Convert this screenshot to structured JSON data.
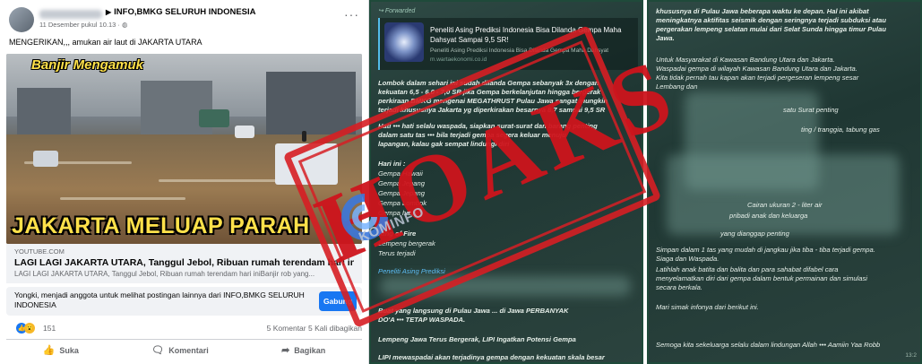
{
  "facebook": {
    "page_name": "INFO,BMKG SELURUH INDONESIA",
    "post_date": "11 Desember pukul 10.13 · ",
    "caption": "MENGERIKAN,,, amukan air laut di JAKARTA UTARA",
    "more_label": "···",
    "image_title_top": "Banjir Mengamuk",
    "image_title_bottom": "JAKARTA MELUAP PARAH",
    "link": {
      "domain": "YOUTUBE.COM",
      "title": "LAGI LAGI JAKARTA UTARA, Tanggul Jebol, Ribuan rumah terendam hari ini",
      "description": "LAGI LAGI JAKARTA UTARA, Tanggul Jebol, Ribuan rumah terendam hari iniBanjir rob yang..."
    },
    "join_prompt": "Yongki, menjadi anggota untuk melihat postingan lainnya dari INFO,BMKG SELURUH INDONESIA",
    "join_button": "Gabung",
    "reaction_count": "151",
    "comments_shares": "5 Komentar  5 Kali dibagikan",
    "actions": {
      "like": "Suka",
      "comment": "Komentari",
      "share": "Bagikan"
    },
    "icons": {
      "like": "thumbs-up-icon",
      "comment": "speech-bubble-icon",
      "share": "share-arrow-icon"
    }
  },
  "chat_left": {
    "forwarded": "Forwarded",
    "preview_title": "Peneliti Asing Prediksi Indonesia Bisa Dilanda Gempa Maha Dahsyat Sampai 9,5 SR!",
    "preview_desc": "Peneliti Asing Prediksi Indonesia Bisa Dilanda Gempa Maha Dahsyat",
    "preview_url": "m.wartaekonomi.co.id",
    "lines": [
      "Lombok dalam sehari ini sudah dilanda Gempa sebanyak 3x dengan",
      "kekuatan 6,5 - 6,0 - 7,0 SR jika Gempa berkelanjutan hingga bergerak",
      "perkiraan BMKG mengenai MEGATHRUST Pulau Jawa sangat mungkin",
      "terjadi khususnya Jakarta yg diperkirakan besarnya 8,7 sampai 9,5 SR",
      "Hati ••• hati selalu waspada, siapkan surat-surat dan barang penting",
      "dalam satu tas ••• bila terjadi gempa segera keluar menuju",
      "lapangan, kalau gak sempat lindungi diri",
      "Hari ini :",
      "Gempa Hawaii",
      "Gempa Jepang",
      "Gempa Jepang",
      "Gempa Lombok",
      "Gempa hari ini",
      "Ring of Fire",
      "Lempeng bergerak",
      "Terus terjadi",
      "Peneliti Asing Prediksi",
      "Buat yang langsung di Pulau Jawa ... di Jawa PERBANYAK",
      "DO'A ••• TETAP WASPADA.",
      "Lempeng Jawa Terus Bergerak, LIPI Ingatkan Potensi Gempa",
      "LIPI mewaspadai akan terjadinya gempa dengan kekuatan skala besar"
    ]
  },
  "chat_right": {
    "lines": [
      "khususnya di Pulau Jawa beberapa waktu ke depan. Hal ini akibat",
      "meningkatnya aktifitas seismik dengan seringnya terjadi subduksi atau",
      "pergerakan lempeng selatan mulai dari Selat Sunda hingga timur Pulau",
      "Jawa.",
      "Untuk Masyarakat di Kawasan Bandung Utara dan Jakarta.",
      "Waspadai gempa di wilayah Kawasan Bandung Utara dan Jakarta.",
      "Kita tidak pernah tau kapan akan terjadi pergeseran lempeng sesar",
      "Lembang dan",
      "satu Surat penting",
      "ting / tranggia, tabung gas",
      "Cairan ukuran 2 - liter air",
      "pribadi anak dan keluarga",
      "yang dianggap penting",
      "Simpan dalam 1 tas yang mudah di jangkau jika tiba - tiba terjadi gempa.",
      "Siaga dan Waspada.",
      "Latihlah anak batita dan balita dan para sahabat difabel cara",
      "menyelamatkan diri dari gempa dalam bentuk permainan dan simulasi",
      "secara berkala.",
      "Mari simak infonya dari berikut ini.",
      "Semoga kita sekeluarga selalu dalam lindungan Allah ••• Aamiin Yaa Robb"
    ],
    "timestamp": "13:2"
  },
  "stamp_text": "HOAKS",
  "logo_text": "KOMINFO",
  "colors": {
    "stamp": "#d61e24",
    "fb_blue": "#1877f2",
    "chat_bg": "#2f4a45"
  }
}
